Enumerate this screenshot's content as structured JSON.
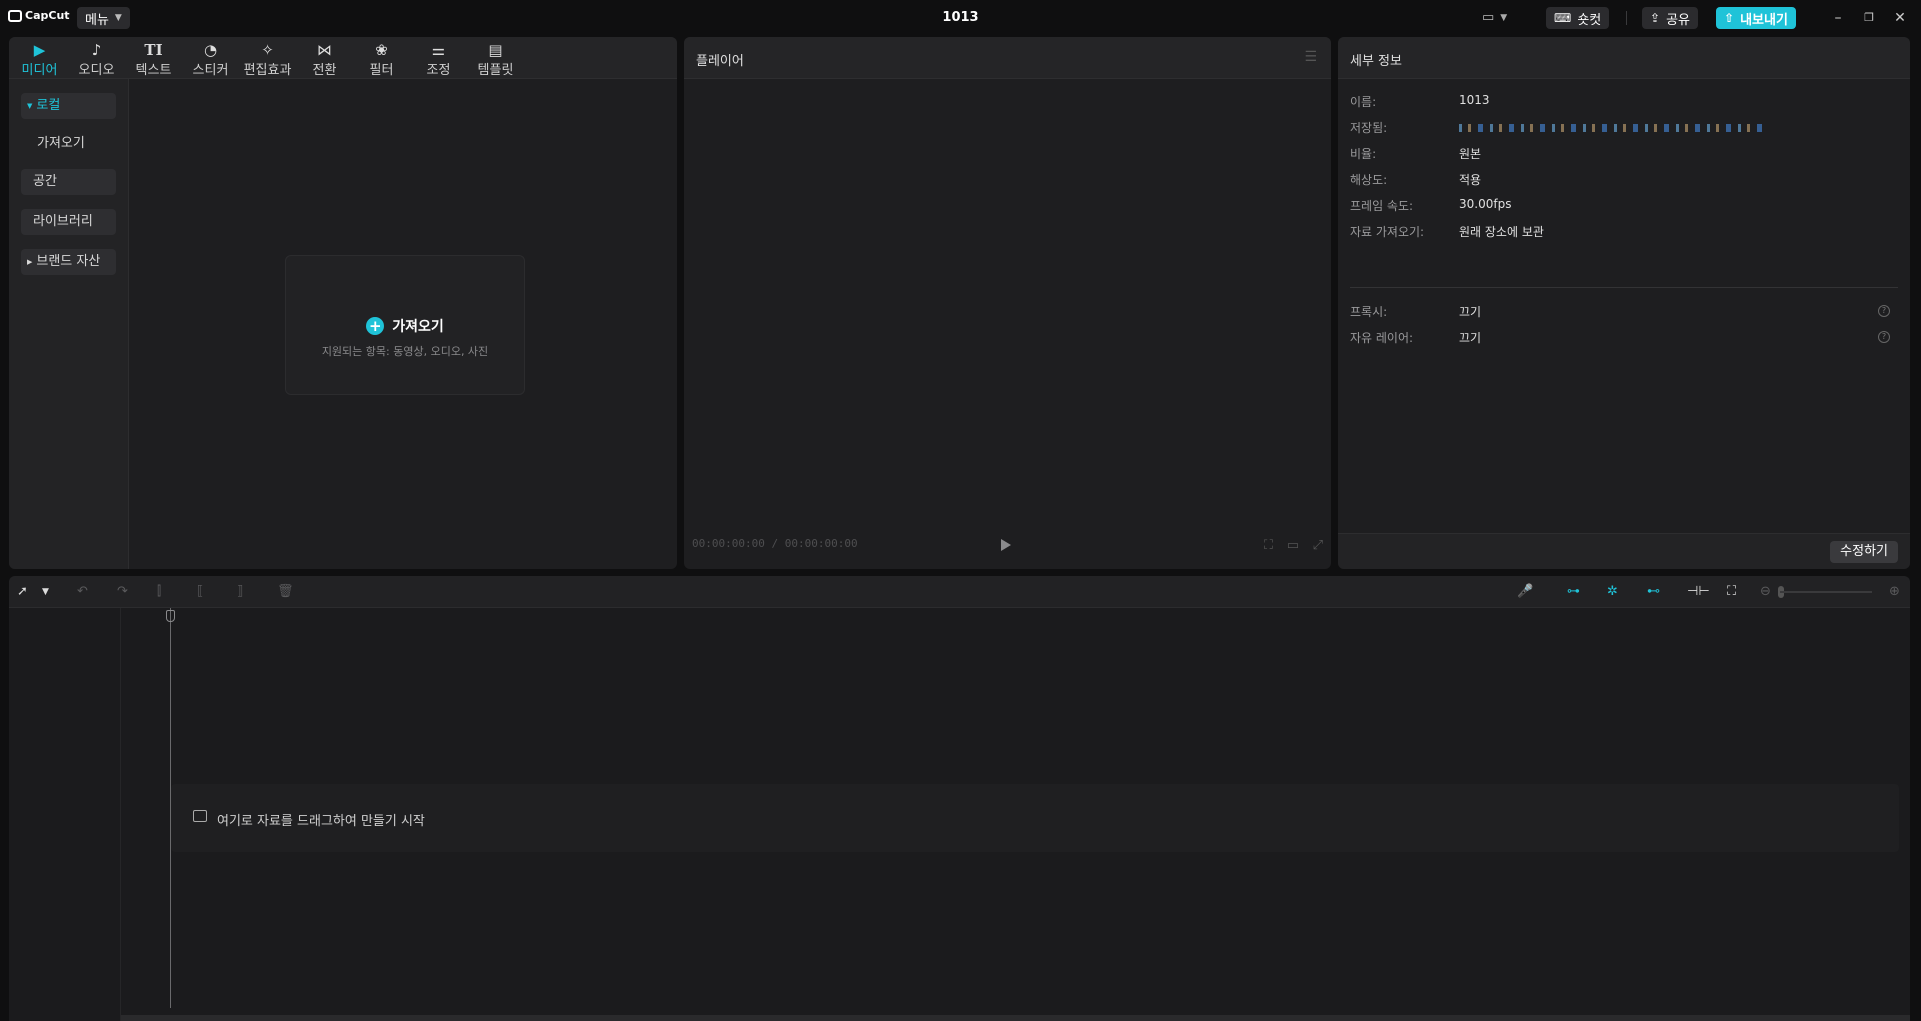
{
  "app": {
    "brand": "CapCut",
    "menu_label": "메뉴",
    "project_title": "1013",
    "shortcut_label": "숏컷",
    "share_label": "공유",
    "export_label": "내보내기"
  },
  "media": {
    "tabs": [
      {
        "label": "미디어",
        "icon": "media-icon"
      },
      {
        "label": "오디오",
        "icon": "audio-icon"
      },
      {
        "label": "텍스트",
        "icon": "text-icon"
      },
      {
        "label": "스티커",
        "icon": "sticker-icon"
      },
      {
        "label": "편집효과",
        "icon": "effects-icon"
      },
      {
        "label": "전환",
        "icon": "transition-icon"
      },
      {
        "label": "필터",
        "icon": "filter-icon"
      },
      {
        "label": "조정",
        "icon": "adjust-icon"
      },
      {
        "label": "템플릿",
        "icon": "template-icon"
      }
    ],
    "side": {
      "local": "로컬",
      "import": "가져오기",
      "space": "공간",
      "library": "라이브러리",
      "brand_assets": "브랜드 자산"
    },
    "import_card": {
      "title": "가져오기",
      "supported": "지원되는 항목: 동영상, 오디오, 사진"
    }
  },
  "player": {
    "title": "플레이어",
    "timecode": "00:00:00:00 / 00:00:00:00"
  },
  "details": {
    "title": "세부 정보",
    "rows": [
      {
        "key": "이름:",
        "value": "1013"
      },
      {
        "key": "저장됨:",
        "value": ""
      },
      {
        "key": "비율:",
        "value": "원본"
      },
      {
        "key": "해상도:",
        "value": "적용"
      },
      {
        "key": "프레임 속도:",
        "value": "30.00fps"
      },
      {
        "key": "자료 가져오기:",
        "value": "원래 장소에 보관"
      }
    ],
    "proxy": {
      "key": "프록시:",
      "value": "끄기"
    },
    "free_layer": {
      "key": "자유 레이어:",
      "value": "끄기"
    },
    "modify_label": "수정하기"
  },
  "timeline": {
    "drop_hint": "여기로 자료를 드래그하여 만들기 시작"
  },
  "colors": {
    "accent": "#1fc3d8",
    "background": "#0f0f10",
    "panel": "#1e1e20"
  }
}
